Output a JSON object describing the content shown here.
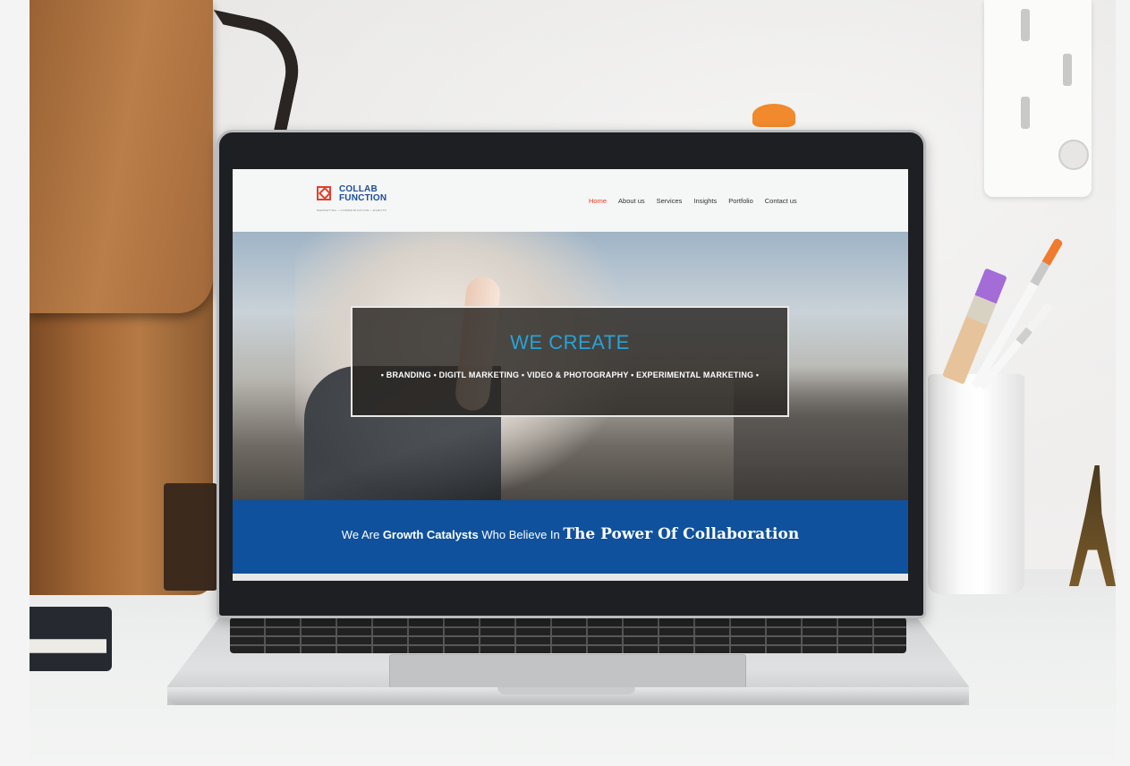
{
  "site": {
    "logo": {
      "line1": "COLLAB",
      "line2": "FUNCTION",
      "tagline": "MARKETING • COMMUNICATION • EVENTS"
    },
    "nav": [
      {
        "label": "Home",
        "active": true
      },
      {
        "label": "About us",
        "active": false
      },
      {
        "label": "Services",
        "active": false
      },
      {
        "label": "Insights",
        "active": false
      },
      {
        "label": "Portfolio",
        "active": false
      },
      {
        "label": "Contact us",
        "active": false
      }
    ],
    "hero": {
      "title": "WE CREATE",
      "services_line": "•  BRANDING  •  DIGITL MARKETING  •  VIDEO & PHOTOGRAPHY  •  EXPERIMENTAL MARKETING  •"
    },
    "banner": {
      "part1": "We Are ",
      "part2": "Growth Catalysts",
      "part3": " Who Believe In ",
      "part4": "The Power Of Collaboration"
    }
  },
  "colors": {
    "accent_red": "#e2402b",
    "brand_blue": "#0f519c",
    "hero_title": "#27a3d6"
  },
  "icons": [
    "collab-function-logo-icon"
  ]
}
